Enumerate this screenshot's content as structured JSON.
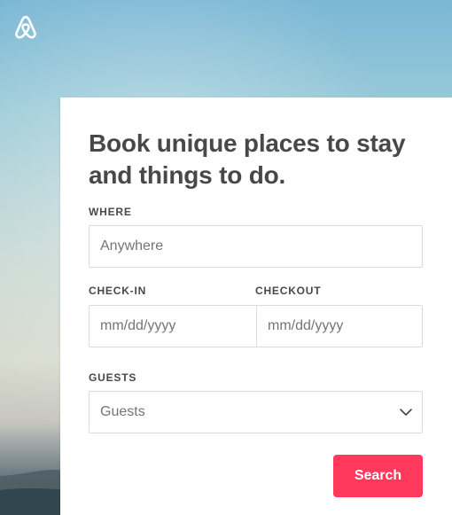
{
  "brand": {
    "logo_icon": "airbnb-logo-icon"
  },
  "booking_form": {
    "title": "Book unique places to stay and things to do.",
    "where": {
      "label": "WHERE",
      "placeholder": "Anywhere"
    },
    "check_in": {
      "label": "CHECK-IN",
      "placeholder": "mm/dd/yyyy"
    },
    "checkout": {
      "label": "CHECKOUT",
      "placeholder": "mm/dd/yyyy"
    },
    "guests": {
      "label": "GUESTS",
      "selected_value": "Guests",
      "icon": "chevron-down-icon"
    },
    "search_button_label": "Search"
  },
  "colors": {
    "accent": "#ff385c",
    "text": "#484848",
    "muted_text": "#757575",
    "border": "#dbdbdb"
  }
}
